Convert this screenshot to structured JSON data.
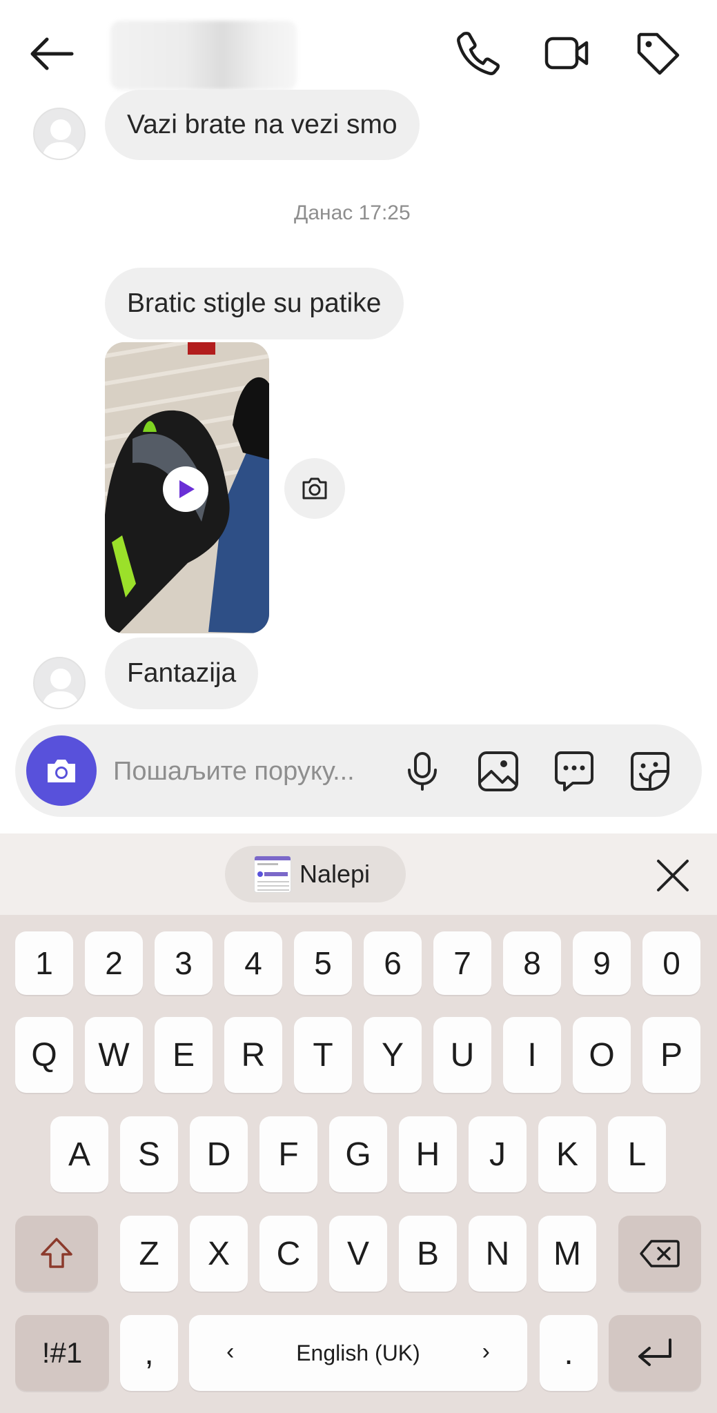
{
  "header": {
    "back_icon": "arrow-left-icon",
    "contact_name": "",
    "actions": [
      {
        "name": "phone-icon"
      },
      {
        "name": "video-camera-icon"
      },
      {
        "name": "tag-icon"
      }
    ]
  },
  "messages": [
    {
      "text": "Vazi brate na vezi smo"
    },
    {
      "text": "Bratic stigle su patike"
    },
    {
      "text": "Fantazija"
    }
  ],
  "timestamp": "Данас 17:25",
  "composer": {
    "placeholder": "Пошаљите поруку..."
  },
  "keyboard": {
    "paste_label": "Nalepi",
    "number_row": [
      "1",
      "2",
      "3",
      "4",
      "5",
      "6",
      "7",
      "8",
      "9",
      "0"
    ],
    "row1": [
      "Q",
      "W",
      "E",
      "R",
      "T",
      "Y",
      "U",
      "I",
      "O",
      "P"
    ],
    "row2": [
      "A",
      "S",
      "D",
      "F",
      "G",
      "H",
      "J",
      "K",
      "L"
    ],
    "row3": [
      "Z",
      "X",
      "C",
      "V",
      "B",
      "N",
      "M"
    ],
    "symbols_label": "!#1",
    "comma": ",",
    "space_label": "English (UK)",
    "left_arrow": "‹",
    "right_arrow": "›",
    "period": "."
  },
  "colors": {
    "accent": "#5851db",
    "bubble": "#efefef",
    "keyboard_bg": "#e6dedb",
    "modifier_key": "#d3c7c3"
  }
}
